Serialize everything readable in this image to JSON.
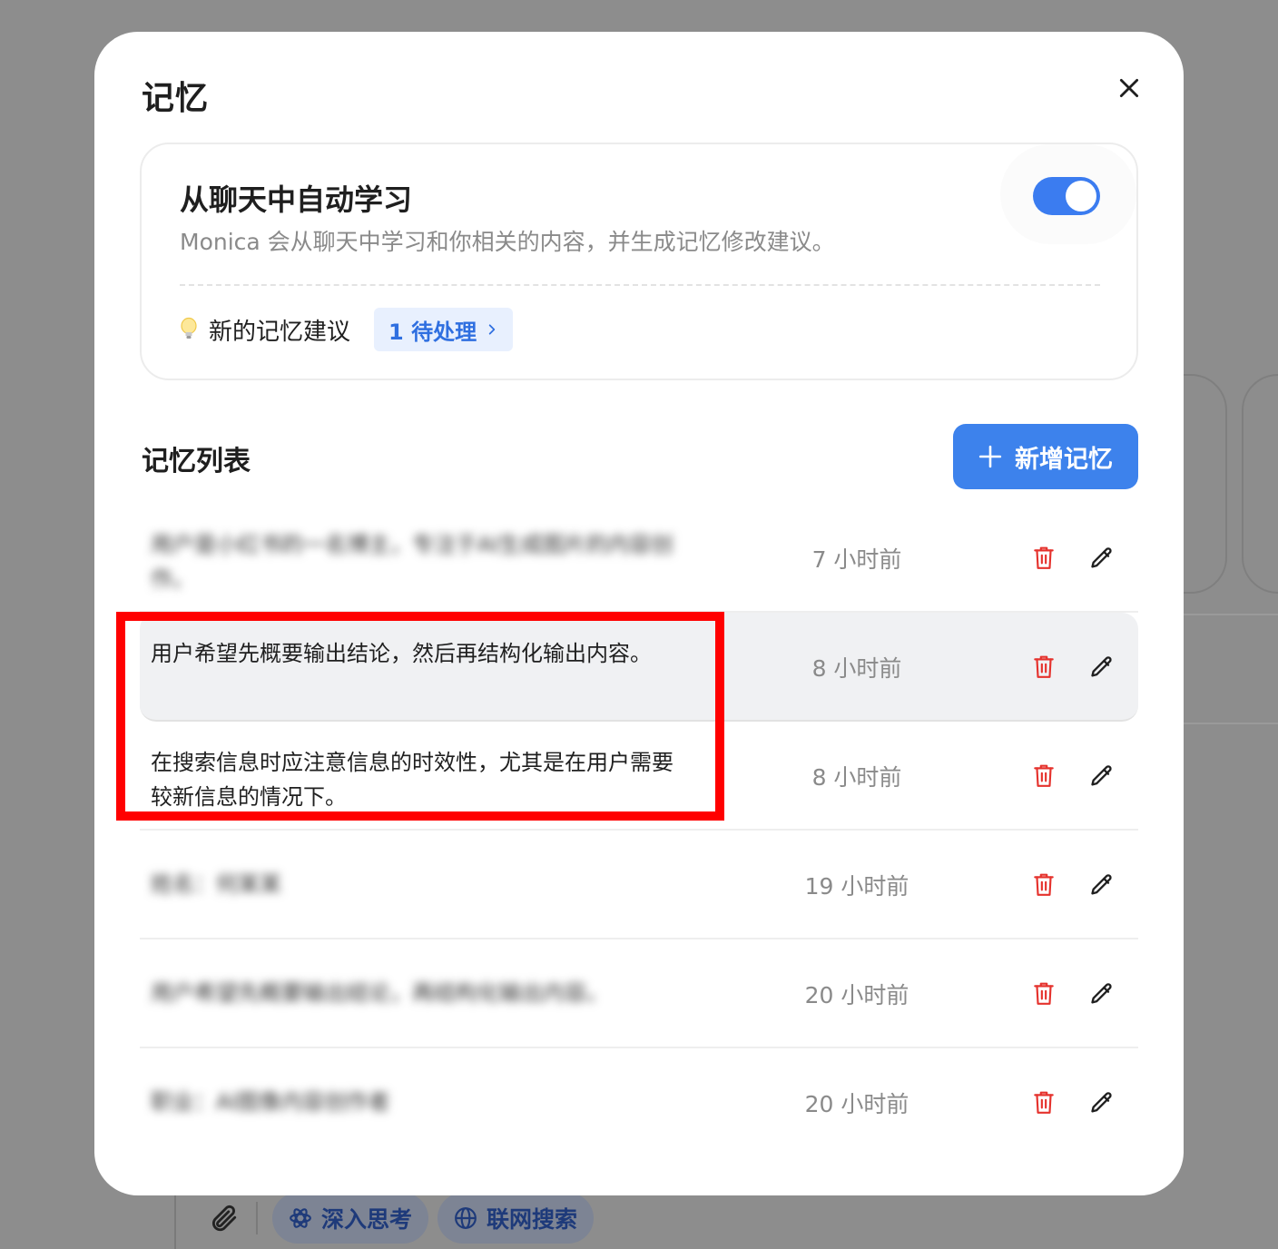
{
  "background": {
    "chips": [
      {
        "label": "深入思考",
        "icon": "atom-icon"
      },
      {
        "label": "联网搜索",
        "icon": "globe-icon"
      }
    ],
    "attach_icon": "paperclip-icon"
  },
  "modal": {
    "title": "记忆",
    "close_icon": "close-icon"
  },
  "auto_learn": {
    "title": "从聊天中自动学习",
    "description": "Monica 会从聊天中学习和你相关的内容，并生成记忆修改建议。",
    "toggle_on": true,
    "accent": "#3b7cf0",
    "suggestions_label": "新的记忆建议",
    "pending_badge": "1 待处理",
    "bulb_icon": "lightbulb-icon"
  },
  "memory_list": {
    "title": "记忆列表",
    "add_button": "新增记忆",
    "items": [
      {
        "text": "用户是小红书的一名博主，专注于AI生成图片的内容创作。",
        "time": "7 小时前",
        "blurred": true
      },
      {
        "text": "用户希望先概要输出结论，然后再结构化输出内容。",
        "time": "8 小时前",
        "blurred": false,
        "highlighted": true
      },
      {
        "text": "在搜索信息时应注意信息的时效性，尤其是在用户需要较新信息的情况下。",
        "time": "8 小时前",
        "blurred": false
      },
      {
        "text": "姓名：何某某",
        "time": "19 小时前",
        "blurred": true
      },
      {
        "text": "用户希望先概要输出结论，再结构化输出内容。",
        "time": "20 小时前",
        "blurred": true
      },
      {
        "text": "职业：AI图像内容创作者",
        "time": "20 小时前",
        "blurred": true
      }
    ],
    "delete_color": "#e5322d"
  }
}
